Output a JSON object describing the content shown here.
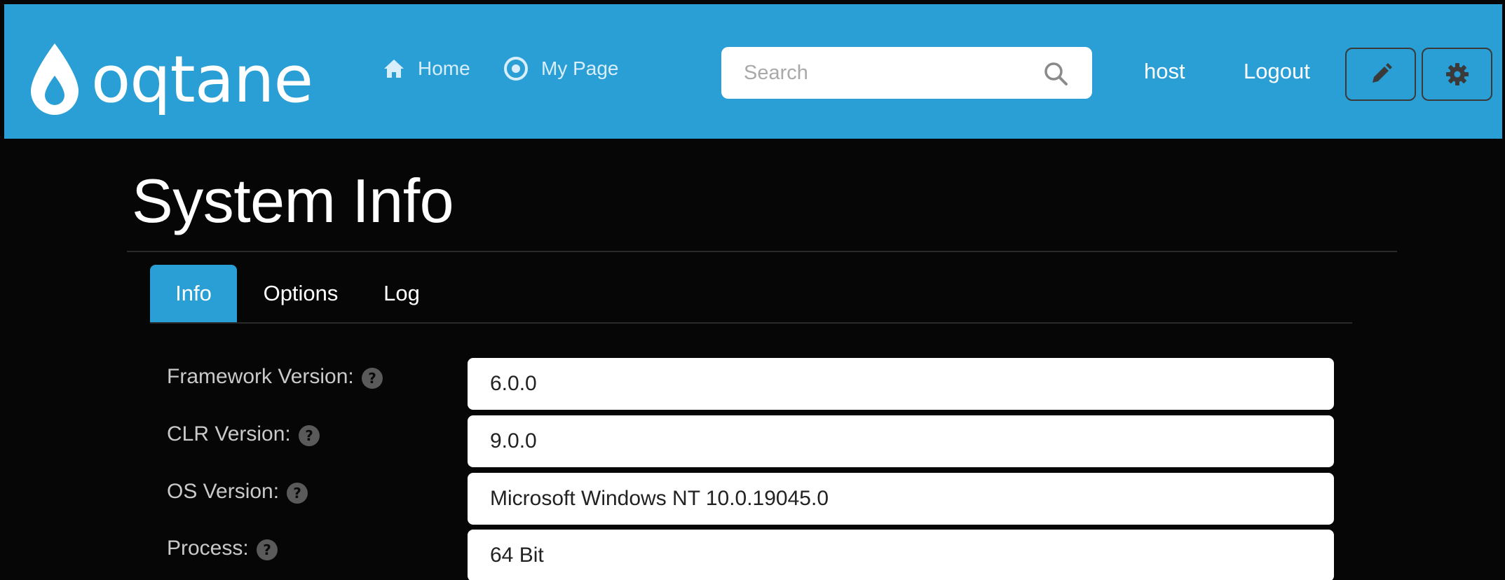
{
  "brand": {
    "name": "oqtane",
    "color": "#2a9fd6"
  },
  "nav": {
    "home_label": "Home",
    "mypage_label": "My Page"
  },
  "search": {
    "placeholder": "Search"
  },
  "user": {
    "name": "host",
    "logout_label": "Logout"
  },
  "page": {
    "title": "System Info"
  },
  "tabs": [
    {
      "label": "Info",
      "active": true
    },
    {
      "label": "Options",
      "active": false
    },
    {
      "label": "Log",
      "active": false
    }
  ],
  "fields": [
    {
      "label": "Framework Version:",
      "value": "6.0.0"
    },
    {
      "label": "CLR Version:",
      "value": "9.0.0"
    },
    {
      "label": "OS Version:",
      "value": "Microsoft Windows NT 10.0.19045.0"
    },
    {
      "label": "Process:",
      "value": "64 Bit"
    }
  ],
  "icons": {
    "home": "home-icon",
    "mypage": "target-icon",
    "search": "search-icon",
    "edit": "pencil-icon",
    "settings": "gear-icon",
    "help": "question-circle-icon"
  }
}
